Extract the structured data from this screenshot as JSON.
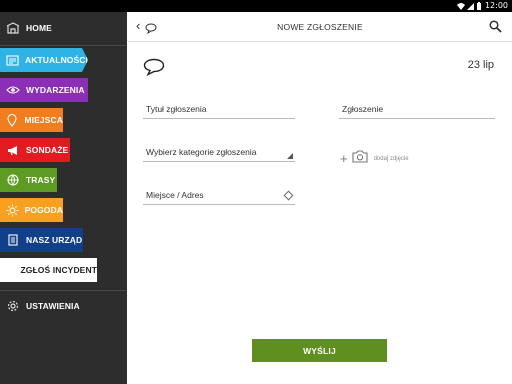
{
  "status_bar": {
    "time": "12:00",
    "icons": [
      "wifi-icon",
      "signal-icon",
      "battery-icon"
    ]
  },
  "drawer": {
    "home_label": "HOME",
    "items": [
      {
        "label": "AKTUALNOŚCI",
        "icon": "news-icon",
        "color": "#2eb3e4",
        "active": true
      },
      {
        "label": "WYDARZENIA",
        "icon": "eye-icon",
        "color": "#8a2fb6"
      },
      {
        "label": "MIEJSCA",
        "icon": "map-pin-icon",
        "color": "#f07d1e"
      },
      {
        "label": "SONDAŻE",
        "icon": "megaphone-icon",
        "color": "#e21a22"
      },
      {
        "label": "TRASY",
        "icon": "globe-icon",
        "color": "#5d9b22"
      },
      {
        "label": "POGODA",
        "icon": "sun-icon",
        "color": "#f8a11f"
      },
      {
        "label": "NASZ URZĄD",
        "icon": "document-icon",
        "color": "#113f8a"
      },
      {
        "label": "ZGŁOŚ INCYDENT",
        "icon": "",
        "color": "#ffffff",
        "text_color": "#222222"
      }
    ],
    "settings_label": "USTAWIENIA"
  },
  "header": {
    "title": "NOWE ZGŁOSZENIE",
    "back_glyph": "‹"
  },
  "form": {
    "date": "23 lip",
    "title_field": "Tytuł zgłoszenia",
    "report_field": "Zgłoszenie",
    "category_field": "Wybierz kategorie zgłoszenia",
    "place_field": "Miejsce / Adres",
    "add_photo_plus": "+",
    "add_photo_label": "dodaj zdjęcie",
    "send_label": "WYŚLIJ"
  },
  "colors": {
    "accent_green": "#5e8f1f",
    "drawer_bg": "#2d2d2d"
  }
}
